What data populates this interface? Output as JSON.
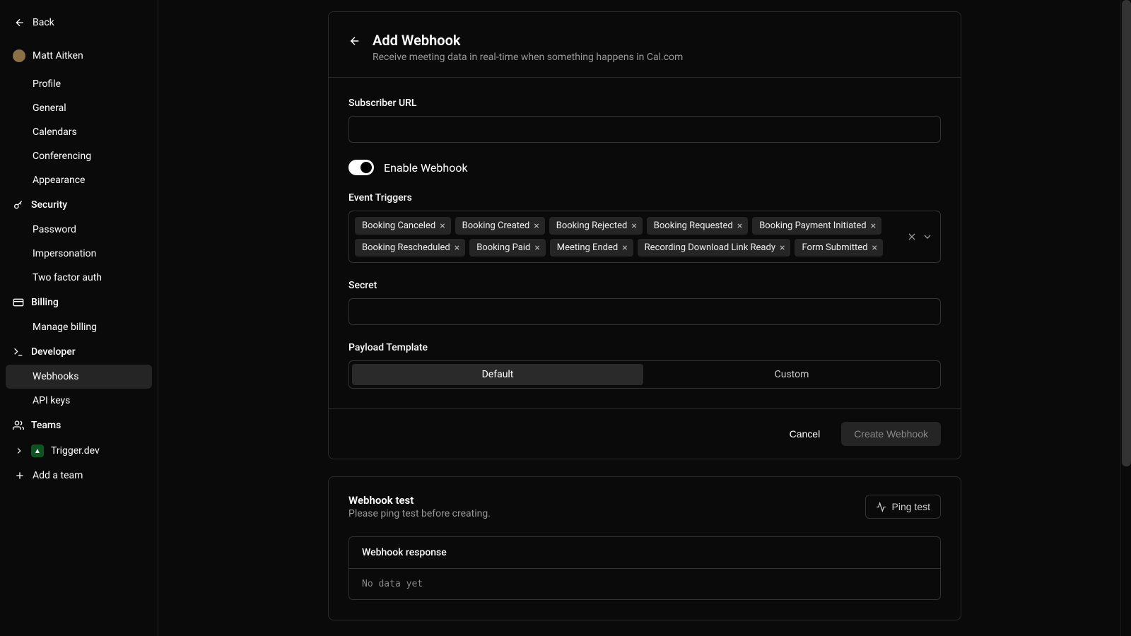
{
  "back_label": "Back",
  "user": {
    "name": "Matt Aitken"
  },
  "sidebar": {
    "profile": "Profile",
    "general": "General",
    "calendars": "Calendars",
    "conferencing": "Conferencing",
    "appearance": "Appearance",
    "security_label": "Security",
    "password": "Password",
    "impersonation": "Impersonation",
    "two_factor": "Two factor auth",
    "billing_label": "Billing",
    "manage_billing": "Manage billing",
    "developer_label": "Developer",
    "webhooks": "Webhooks",
    "api_keys": "API keys",
    "teams_label": "Teams",
    "team_name": "Trigger.dev",
    "add_team": "Add a team"
  },
  "header": {
    "title": "Add Webhook",
    "subtitle": "Receive meeting data in real-time when something happens in Cal.com"
  },
  "form": {
    "subscriber_url_label": "Subscriber URL",
    "enable_label": "Enable Webhook",
    "triggers_label": "Event Triggers",
    "triggers": [
      "Booking Canceled",
      "Booking Created",
      "Booking Rejected",
      "Booking Requested",
      "Booking Payment Initiated",
      "Booking Rescheduled",
      "Booking Paid",
      "Meeting Ended",
      "Recording Download Link Ready",
      "Form Submitted"
    ],
    "secret_label": "Secret",
    "payload_label": "Payload Template",
    "payload_default": "Default",
    "payload_custom": "Custom"
  },
  "footer": {
    "cancel": "Cancel",
    "create": "Create Webhook"
  },
  "test": {
    "title": "Webhook test",
    "subtitle": "Please ping test before creating.",
    "ping": "Ping test",
    "response_label": "Webhook response",
    "response_body": "No data yet"
  }
}
